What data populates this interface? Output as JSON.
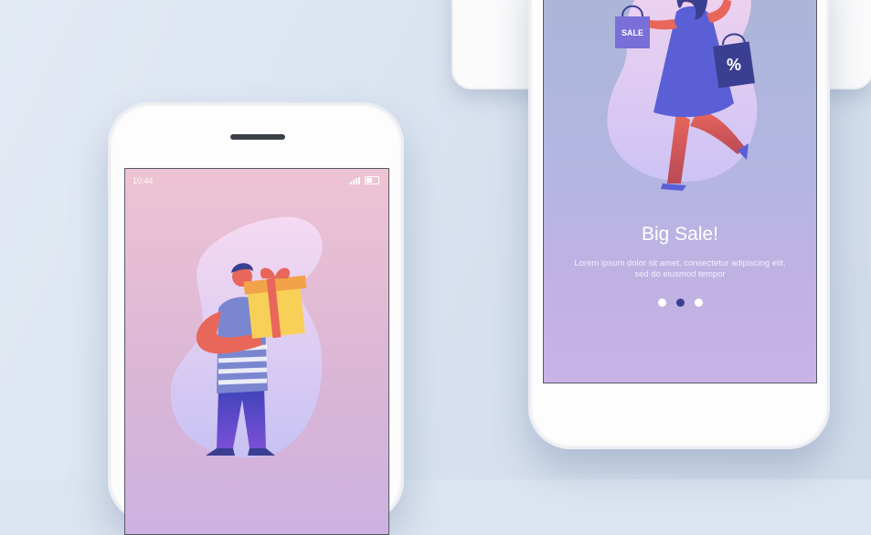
{
  "left_phone": {
    "status_time": "10:44",
    "signal_icon": "signal-bars-icon",
    "battery_icon": "battery-icon",
    "illustration": "man-holding-gift-icon"
  },
  "right_phone": {
    "illustration": "woman-shopping-bags-icon",
    "bag_left_text": "SALE",
    "bag_right_text": "%",
    "title": "Big Sale!",
    "body": "Lorem ipsum dolor sit amet, consectetur adipiscing elit, sed do eiusmod tempor",
    "pager": {
      "count": 3,
      "active_index": 1
    }
  },
  "colors": {
    "background": "#dbe4f0",
    "active_dot": "#3b3f91",
    "accent_red": "#e8665a",
    "accent_purple": "#5a5fd6"
  }
}
